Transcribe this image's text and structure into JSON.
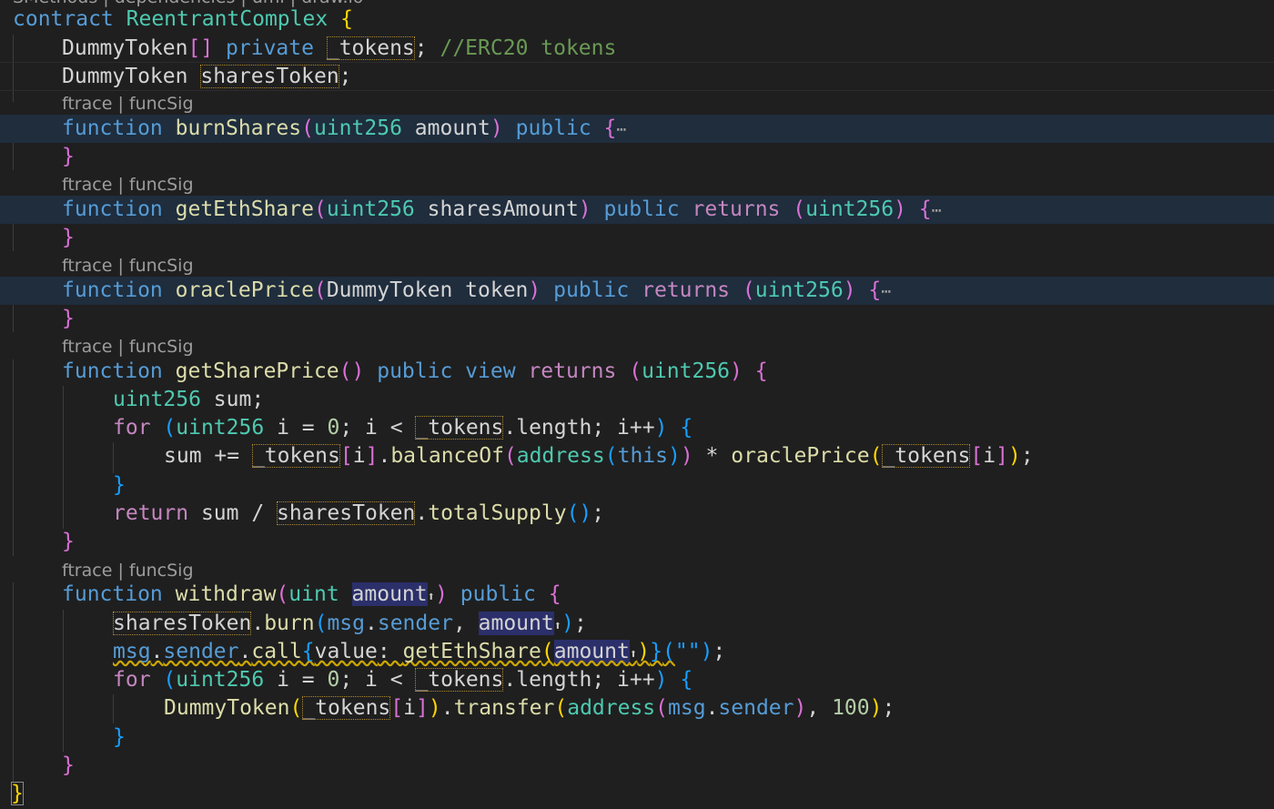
{
  "top_fragment": "SMethods | dependencies | uml | draw.io",
  "codelens": {
    "ftrace": "ftrace",
    "sep": " | ",
    "funcsig": "funcSig"
  },
  "tok": {
    "contract": "contract",
    "ReentrantComplex": "ReentrantComplex",
    "DummyToken": "DummyToken",
    "private": "private",
    "_tokens": "_tokens",
    "sharesToken": "sharesToken",
    "comment": "//ERC20 tokens",
    "function": "function",
    "uint256": "uint256",
    "uint": "uint",
    "public": "public",
    "view": "view",
    "returns": "returns",
    "return": "return",
    "for": "for",
    "address": "address",
    "this": "this",
    "burnShares": "burnShares",
    "amount": "amount",
    "getEthShare": "getEthShare",
    "sharesAmount": "sharesAmount",
    "oraclePrice": "oraclePrice",
    "token": "token",
    "getSharePrice": "getSharePrice",
    "sum": "sum",
    "i": "i",
    "length": "length",
    "balanceOf": "balanceOf",
    "totalSupply": "totalSupply",
    "withdraw": "withdraw",
    "burn": "burn",
    "msg": "msg",
    "sender": "sender",
    "call": "call",
    "value": "value",
    "transfer": "transfer",
    "zero": "0",
    "hundred": "100",
    "empty_string": "\"\"",
    "ellipsis": "⋯",
    "arrow": "⬆"
  }
}
